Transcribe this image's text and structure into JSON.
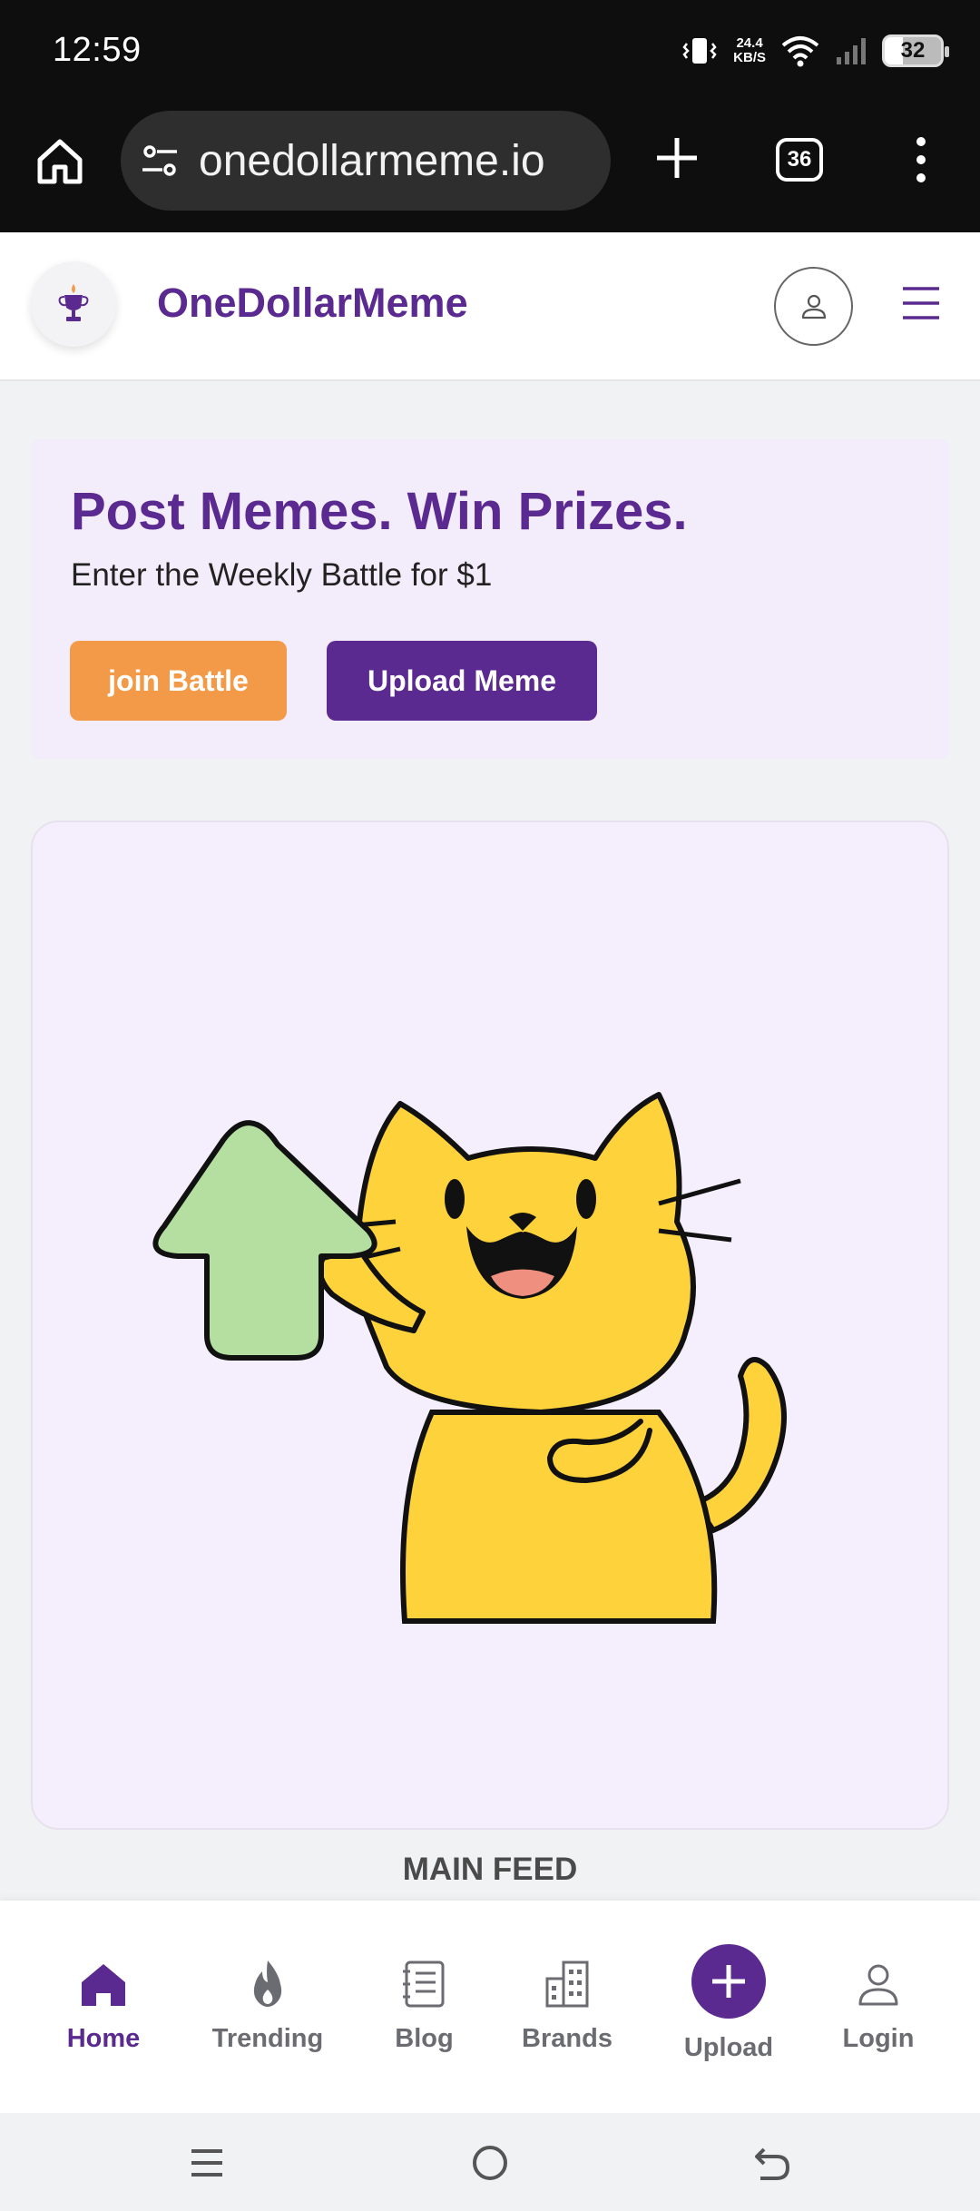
{
  "status_bar": {
    "time": "12:59",
    "net_speed_value": "24.4",
    "net_speed_unit": "KB/S",
    "battery": "32",
    "icons": [
      "vibrate-icon",
      "wifi-icon",
      "signal-icon",
      "battery-icon"
    ]
  },
  "browser": {
    "url": "onedollarmeme.io",
    "tab_count": "36",
    "icons": [
      "home-icon",
      "site-settings-icon",
      "plus-icon",
      "more-icon"
    ]
  },
  "header": {
    "site_title": "OneDollarMeme",
    "icons": [
      "trophy-logo-icon",
      "user-icon",
      "hamburger-icon"
    ]
  },
  "hero": {
    "title": "Post Memes. Win Prizes.",
    "subtitle": "Enter the Weekly Battle for $1",
    "join_label": "join Battle",
    "upload_label": "Upload Meme"
  },
  "meme_card": {
    "illustration": "yellow-cat-upvote-arrow"
  },
  "feed": {
    "label": "MAIN FEED"
  },
  "bottom_nav": {
    "items": [
      {
        "label": "Home",
        "icon": "home-icon",
        "active": true
      },
      {
        "label": "Trending",
        "icon": "flame-icon",
        "active": false
      },
      {
        "label": "Blog",
        "icon": "notebook-icon",
        "active": false
      },
      {
        "label": "Brands",
        "icon": "buildings-icon",
        "active": false
      },
      {
        "label": "Upload",
        "icon": "plus-icon",
        "active": false
      },
      {
        "label": "Login",
        "icon": "user-icon",
        "active": false
      }
    ]
  },
  "colors": {
    "brand_purple": "#5b2a91",
    "orange": "#f39a48",
    "hero_bg": "#f3ecfb",
    "card_bg": "#f5eefc"
  }
}
